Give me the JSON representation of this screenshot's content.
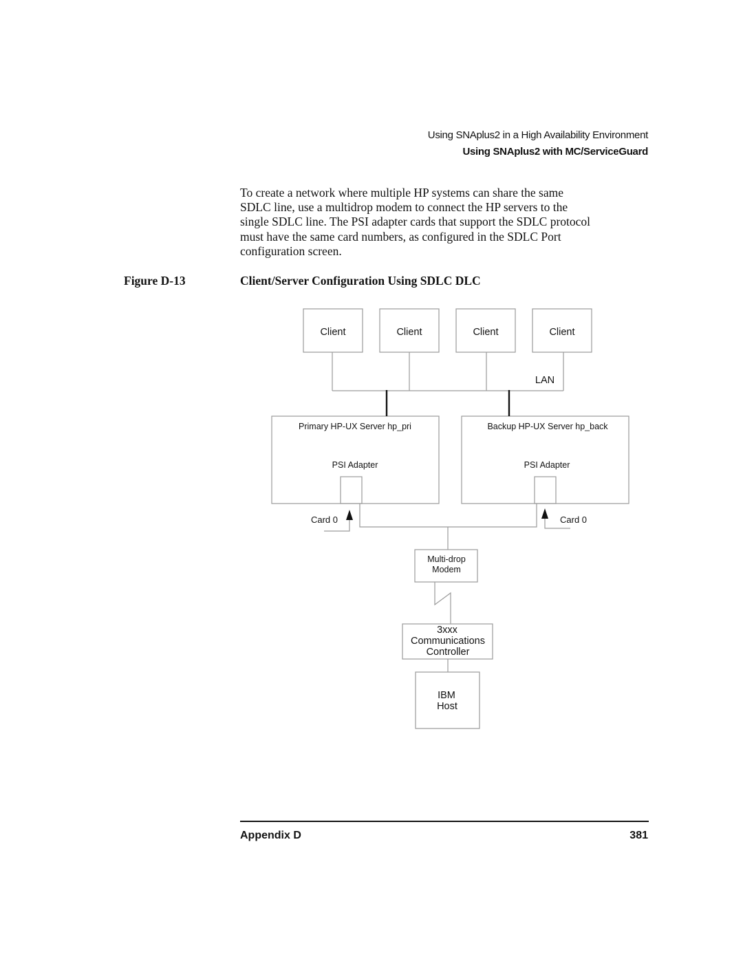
{
  "header": {
    "chapter_title": "Using SNAplus2 in a High Availability Environment",
    "section_title": "Using SNAplus2 with MC/ServiceGuard"
  },
  "body": {
    "paragraph_lines": [
      "To create a network where multiple HP systems can share the same",
      "SDLC line, use a multidrop modem to connect the HP servers to the",
      "single SDLC line. The PSI adapter cards that support the SDLC protocol",
      "must have the same card numbers, as configured in the SDLC Port",
      "configuration screen."
    ]
  },
  "figure": {
    "label": "Figure D-13",
    "title": "Client/Server Configuration Using SDLC DLC",
    "clients": [
      "Client",
      "Client",
      "Client",
      "Client"
    ],
    "lan_label": "LAN",
    "primary_server": {
      "title": "Primary HP-UX Server hp_pri",
      "adapter_label": "PSI Adapter",
      "card_label": "Card 0"
    },
    "backup_server": {
      "title": "Backup HP-UX Server hp_back",
      "adapter_label": "PSI Adapter",
      "card_label": "Card 0"
    },
    "modem": {
      "line1": "Multi-drop",
      "line2": "Modem"
    },
    "controller": {
      "line1": "3xxx",
      "line2": "Communications",
      "line3": "Controller"
    },
    "host": {
      "line1": "IBM",
      "line2": "Host"
    }
  },
  "footer": {
    "section": "Appendix D",
    "page_number": "381"
  }
}
